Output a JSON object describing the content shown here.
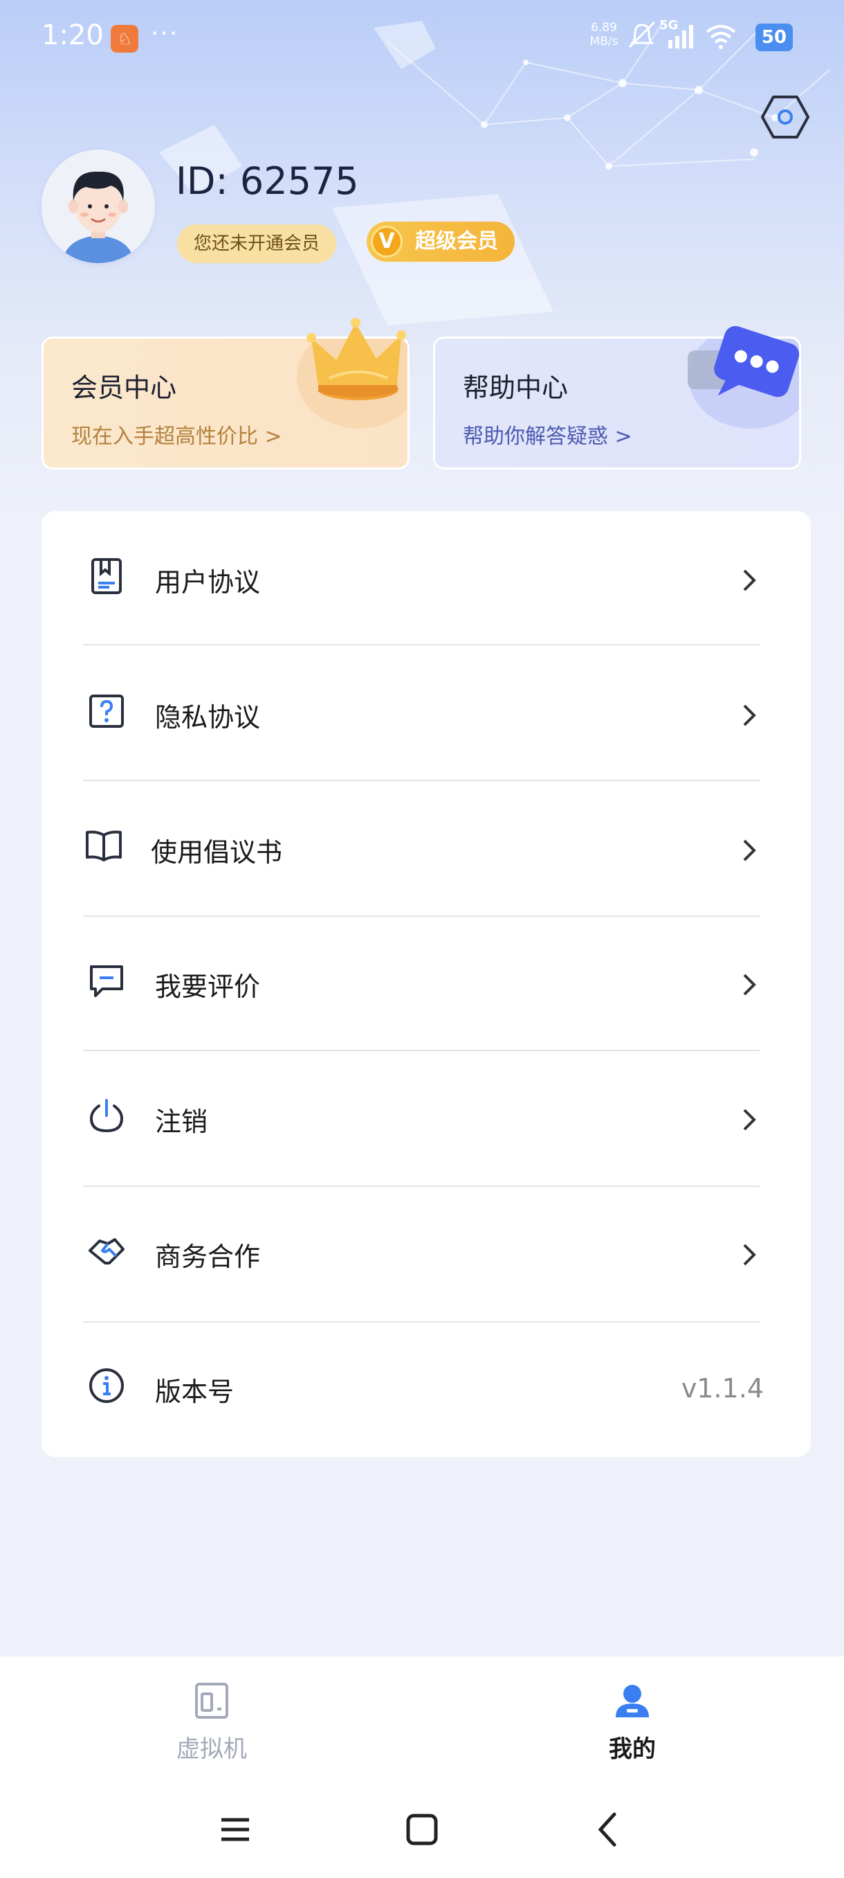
{
  "status_bar": {
    "time": "1:20",
    "app_icon_glyph": "♘",
    "more": "···",
    "speed_value": "6.89",
    "speed_unit": "MB/s",
    "network": "5G",
    "battery": "50"
  },
  "profile": {
    "user_id": "ID: 62575",
    "membership_status": "您还未开通会员",
    "super_member": "超级会员",
    "super_member_mark": "V"
  },
  "cards": {
    "member": {
      "title": "会员中心",
      "subtitle": "现在入手超高性价比 >"
    },
    "help": {
      "title": "帮助中心",
      "subtitle": "帮助你解答疑惑 >"
    }
  },
  "menu": {
    "items": [
      {
        "label": "用户协议",
        "icon": "book-bookmark-icon"
      },
      {
        "label": "隐私协议",
        "icon": "question-box-icon"
      },
      {
        "label": "使用倡议书",
        "icon": "open-book-icon"
      },
      {
        "label": "我要评价",
        "icon": "comment-icon"
      },
      {
        "label": "注销",
        "icon": "power-icon"
      },
      {
        "label": "商务合作",
        "icon": "handshake-icon"
      },
      {
        "label": "版本号",
        "icon": "info-icon",
        "value": "v1.1.4"
      }
    ]
  },
  "bottom_nav": {
    "tabs": [
      {
        "label": "虚拟机",
        "icon": "virtual-machine-icon",
        "active": false
      },
      {
        "label": "我的",
        "icon": "person-icon",
        "active": true
      }
    ]
  },
  "colors": {
    "accent": "#3a7ff2",
    "gold": "#f5b43a",
    "background": "#eef1fa"
  }
}
